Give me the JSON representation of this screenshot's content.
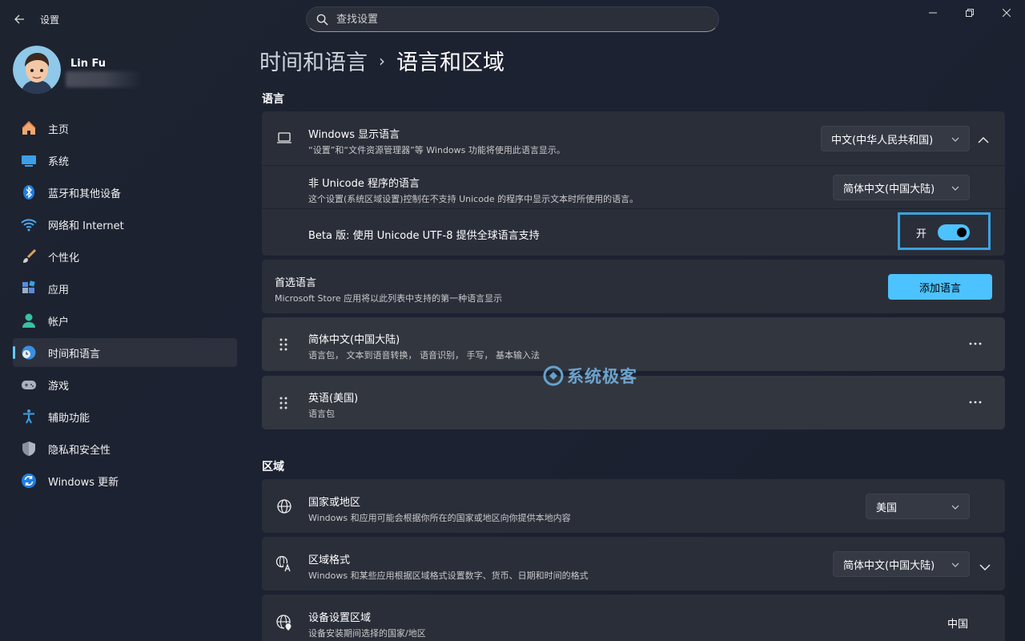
{
  "app": {
    "title": "设置"
  },
  "search": {
    "placeholder": "查找设置"
  },
  "user": {
    "name": "Lin Fu"
  },
  "sidebar": {
    "items": [
      {
        "label": "主页"
      },
      {
        "label": "系统"
      },
      {
        "label": "蓝牙和其他设备"
      },
      {
        "label": "网络和 Internet"
      },
      {
        "label": "个性化"
      },
      {
        "label": "应用"
      },
      {
        "label": "帐户"
      },
      {
        "label": "时间和语言"
      },
      {
        "label": "游戏"
      },
      {
        "label": "辅助功能"
      },
      {
        "label": "隐私和安全性"
      },
      {
        "label": "Windows 更新"
      }
    ]
  },
  "breadcrumb": {
    "parent": "时间和语言",
    "current": "语言和区域"
  },
  "language": {
    "section_title": "语言",
    "display": {
      "title": "Windows 显示语言",
      "desc": "“设置”和“文件资源管理器”等 Windows 功能将使用此语言显示。",
      "value": "中文(中华人民共和国)"
    },
    "non_unicode": {
      "title": "非 Unicode 程序的语言",
      "desc": "这个设置(系统区域设置)控制在不支持 Unicode 的程序中显示文本时所使用的语言。",
      "value": "简体中文(中国大陆)"
    },
    "utf8": {
      "title": "Beta 版: 使用 Unicode UTF-8 提供全球语言支持",
      "state_label": "开",
      "on": true
    },
    "preferred": {
      "title": "首选语言",
      "desc": "Microsoft Store 应用将以此列表中支持的第一种语言显示",
      "add_label": "添加语言"
    },
    "languages": [
      {
        "title": "简体中文(中国大陆)",
        "desc": "语言包， 文本到语音转换， 语音识别， 手写， 基本输入法"
      },
      {
        "title": "英语(美国)",
        "desc": "语言包"
      }
    ]
  },
  "region": {
    "section_title": "区域",
    "country": {
      "title": "国家或地区",
      "desc": "Windows 和应用可能会根据你所在的国家或地区向你提供本地内容",
      "value": "美国"
    },
    "format": {
      "title": "区域格式",
      "desc": "Windows 和某些应用根据区域格式设置数字、货币、日期和时间的格式",
      "value": "简体中文(中国大陆)"
    },
    "device": {
      "title": "设备设置区域",
      "desc": "设备安装期间选择的国家/地区",
      "value": "中国"
    }
  },
  "watermark": {
    "text": "系统极客"
  },
  "colors": {
    "accent": "#4cc2ff",
    "highlight": "#3aa3e0",
    "card": "#2a2e39",
    "background": "#1c2130"
  }
}
